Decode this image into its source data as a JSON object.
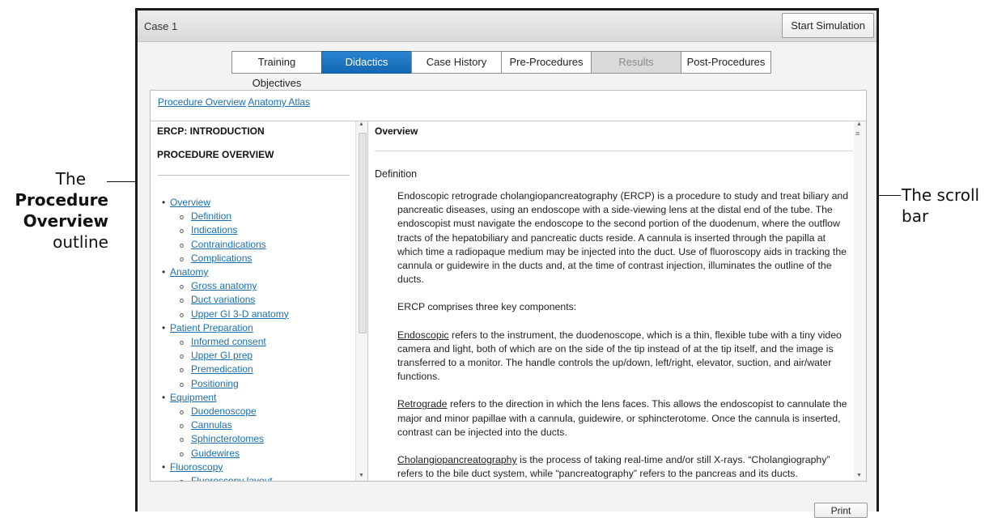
{
  "callouts": {
    "left_line1": "The",
    "left_line2": "Procedure",
    "left_line3": "Overview",
    "left_line4": "outline",
    "right_line1": "The scroll",
    "right_line2": "bar"
  },
  "window": {
    "title": "Case 1",
    "start_button": "Start Simulation"
  },
  "tabs": [
    {
      "label": "Training Objectives",
      "state": "normal"
    },
    {
      "label": "Didactics",
      "state": "active"
    },
    {
      "label": "Case History",
      "state": "normal"
    },
    {
      "label": "Pre-Procedures",
      "state": "normal"
    },
    {
      "label": "Results",
      "state": "disabled"
    },
    {
      "label": "Post-Procedures",
      "state": "normal"
    }
  ],
  "links": {
    "procedure_overview": "Procedure Overview",
    "anatomy_atlas": "Anatomy Atlas"
  },
  "left_pane": {
    "heading1": "ERCP: INTRODUCTION",
    "heading2": "PROCEDURE OVERVIEW",
    "outline": [
      {
        "level": 1,
        "label": "Overview"
      },
      {
        "level": 2,
        "label": "Definition"
      },
      {
        "level": 2,
        "label": "Indications"
      },
      {
        "level": 2,
        "label": "Contraindications"
      },
      {
        "level": 2,
        "label": "Complications"
      },
      {
        "level": 1,
        "label": "Anatomy"
      },
      {
        "level": 2,
        "label": "Gross anatomy"
      },
      {
        "level": 2,
        "label": "Duct variations"
      },
      {
        "level": 2,
        "label": "Upper GI 3-D anatomy"
      },
      {
        "level": 1,
        "label": "Patient Preparation"
      },
      {
        "level": 2,
        "label": "Informed consent"
      },
      {
        "level": 2,
        "label": "Upper GI prep"
      },
      {
        "level": 2,
        "label": "Premedication"
      },
      {
        "level": 2,
        "label": "Positioning"
      },
      {
        "level": 1,
        "label": "Equipment"
      },
      {
        "level": 2,
        "label": "Duodenoscope"
      },
      {
        "level": 2,
        "label": "Cannulas"
      },
      {
        "level": 2,
        "label": "Sphincterotomes"
      },
      {
        "level": 2,
        "label": "Guidewires"
      },
      {
        "level": 1,
        "label": "Fluoroscopy"
      },
      {
        "level": 2,
        "label": "Fluoroscopy layout"
      }
    ]
  },
  "right_pane": {
    "title": "Overview",
    "section": "Definition",
    "p1": "Endoscopic retrograde cholangiopancreatography (ERCP) is a procedure to study and treat biliary and pancreatic diseases, using an endoscope with a side-viewing lens at the distal end of the tube. The endoscopist must navigate the endoscope to the second portion of the duodenum, where the outflow tracts of the hepatobiliary and pancreatic ducts reside. A cannula is inserted through the papilla at which time a radiopaque medium may be injected into the duct. Use of fluoroscopy aids in tracking the cannula or guidewire in the ducts and, at the time of contrast injection, illuminates the outline of the ducts.",
    "p2": "ERCP comprises three key components:",
    "p3_term": "Endoscopic",
    "p3_rest": " refers to the instrument, the duodenoscope, which is a thin, flexible tube with a tiny video camera and light, both of which are on the side of the tip instead of at the tip itself, and the image is transferred to a monitor. The handle controls the up/down, left/right, elevator, suction, and air/water functions.",
    "p4_term": "Retrograde",
    "p4_rest": " refers to the direction in which the lens faces. This allows the endoscopist to cannulate the major and minor papillae with a cannula, guidewire, or sphincterotome. Once the cannula is inserted, contrast can be injected into the ducts.",
    "p5_term": "Cholangiopancreatography",
    "p5_rest": " is the process of taking real-time and/or still X-rays. “Cholangiography” refers to the bile duct system, while “pancreatography” refers to the pancreas and its ducts."
  },
  "print_button": "Print",
  "icons": {
    "scroll_up": "scroll-up-arrow-icon",
    "scroll_down": "scroll-down-arrow-icon"
  },
  "colors": {
    "active_tab": "#1a74c4",
    "link": "#1a6fb0",
    "disabled_tab": "#d9d9d9"
  }
}
